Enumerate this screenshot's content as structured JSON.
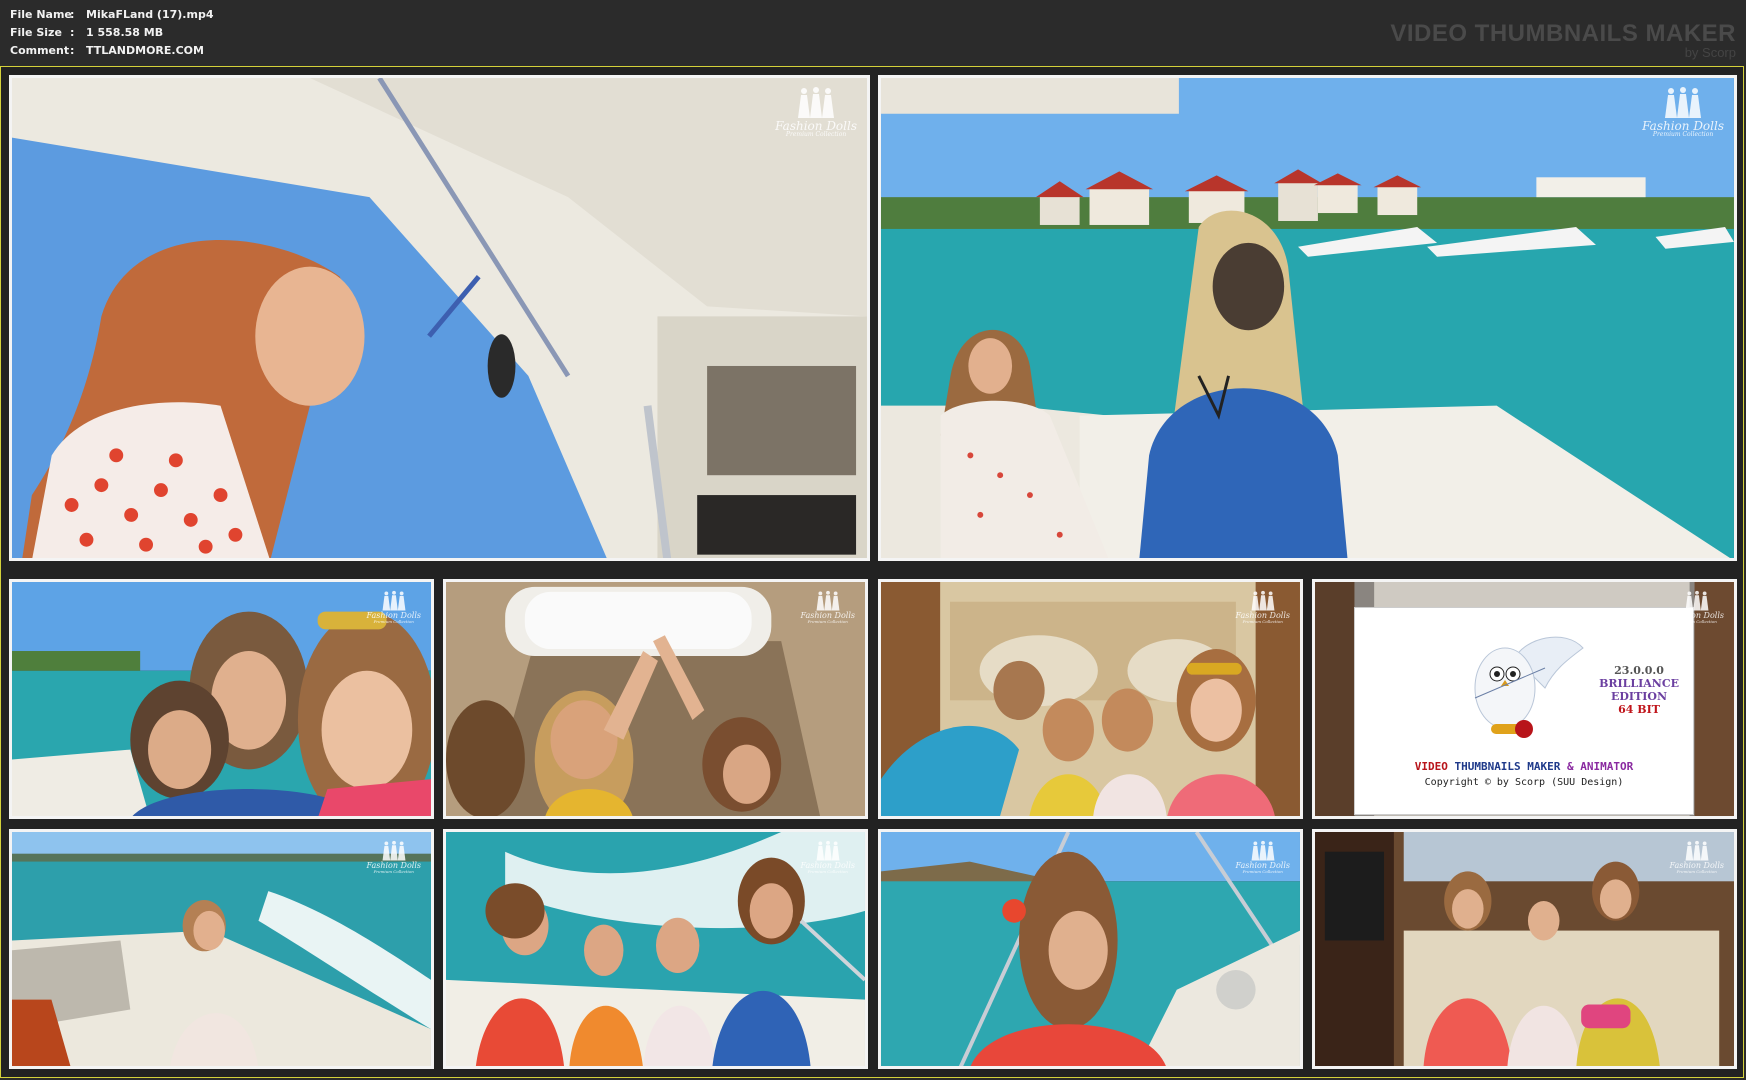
{
  "header": {
    "fields": [
      {
        "key": "File Name",
        "sep": ":",
        "value": "MikaFLand (17).mp4"
      },
      {
        "key": "File Size",
        "sep": ":",
        "value": "1 558.58 MB"
      },
      {
        "key": "Comment",
        "sep": ":",
        "value": "TTLANDMORE.COM"
      }
    ],
    "brand_title": "VIDEO THUMBNAILS MAKER",
    "brand_sub": "by Scorp"
  },
  "watermark": {
    "line1": "Fashion Dolls",
    "line2": "Premium Collection"
  },
  "splash": {
    "version": "23.0.0.0",
    "edition1": "BRILLIANCE",
    "edition2": "EDITION",
    "bits": "64 BIT",
    "product_a": "VIDEO",
    "product_b": "THUMBNAILS MAKER",
    "product_c": "& ANIMATOR",
    "copyright": "Copyright © by Scorp (SUU Design)"
  },
  "colors": {
    "sheet_border": "#d4d13a",
    "frame_border": "#f4f4f4",
    "background": "#2b2b2b",
    "sky": "#5c9be0",
    "water": "#2aa8b0",
    "boat": "#ece9e0",
    "dress_red": "#e8473a"
  },
  "thumbnails": [
    {
      "scene": "boat-deck-low-angle"
    },
    {
      "scene": "girls-on-boat-marina"
    },
    {
      "scene": "selfie-girls-lake"
    },
    {
      "scene": "cabin-hatch"
    },
    {
      "scene": "girls-on-bed-cabin"
    },
    {
      "scene": "vtm-splash"
    },
    {
      "scene": "girl-on-stern-wake"
    },
    {
      "scene": "four-girls-on-deck"
    },
    {
      "scene": "girl-with-flower-bow"
    },
    {
      "scene": "girls-on-sofa-cabin"
    }
  ]
}
